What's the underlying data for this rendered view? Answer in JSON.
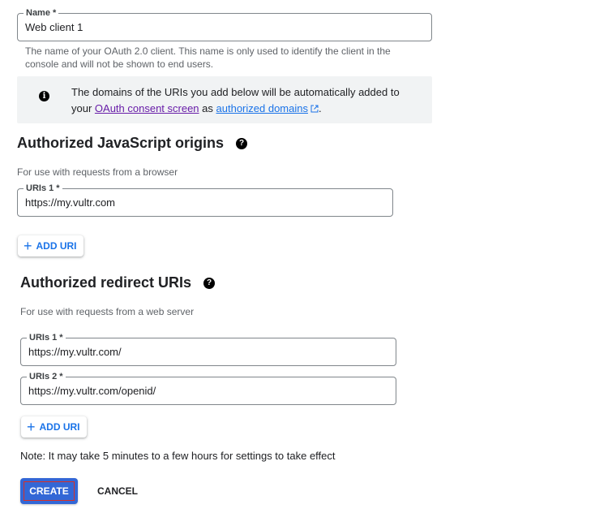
{
  "name_field": {
    "label": "Name *",
    "value": "Web client 1",
    "hint": "The name of your OAuth 2.0 client. This name is only used to identify the client in the console and will not be shown to end users."
  },
  "info_box": {
    "icon": "info-icon",
    "text_before": "The domains of the URIs you add below will be automatically added to your ",
    "link1": "OAuth consent screen",
    "text_middle": " as ",
    "link2": "authorized domains",
    "link2_icon": "external-link-icon",
    "text_after": "."
  },
  "js_origins": {
    "title": "Authorized JavaScript origins",
    "help_icon": "help-icon",
    "description": "For use with requests from a browser",
    "uris": [
      {
        "label": "URIs 1 *",
        "value": "https://my.vultr.com"
      }
    ],
    "add_button": "ADD URI"
  },
  "redirect_uris": {
    "title": "Authorized redirect URIs",
    "help_icon": "help-icon",
    "description": "For use with requests from a web server",
    "uris": [
      {
        "label": "URIs 1 *",
        "value": "https://my.vultr.com/"
      },
      {
        "label": "URIs 2 *",
        "value": "https://my.vultr.com/openid/"
      }
    ],
    "add_button": "ADD URI"
  },
  "note": "Note: It may take 5 minutes to a few hours for settings to take effect",
  "actions": {
    "create": "CREATE",
    "cancel": "CANCEL"
  },
  "colors": {
    "primary": "#3367d6",
    "link": "#1a73e8",
    "visited_link": "#681da8",
    "info_background": "#f1f3f4",
    "focus_outline": "#d93025"
  }
}
